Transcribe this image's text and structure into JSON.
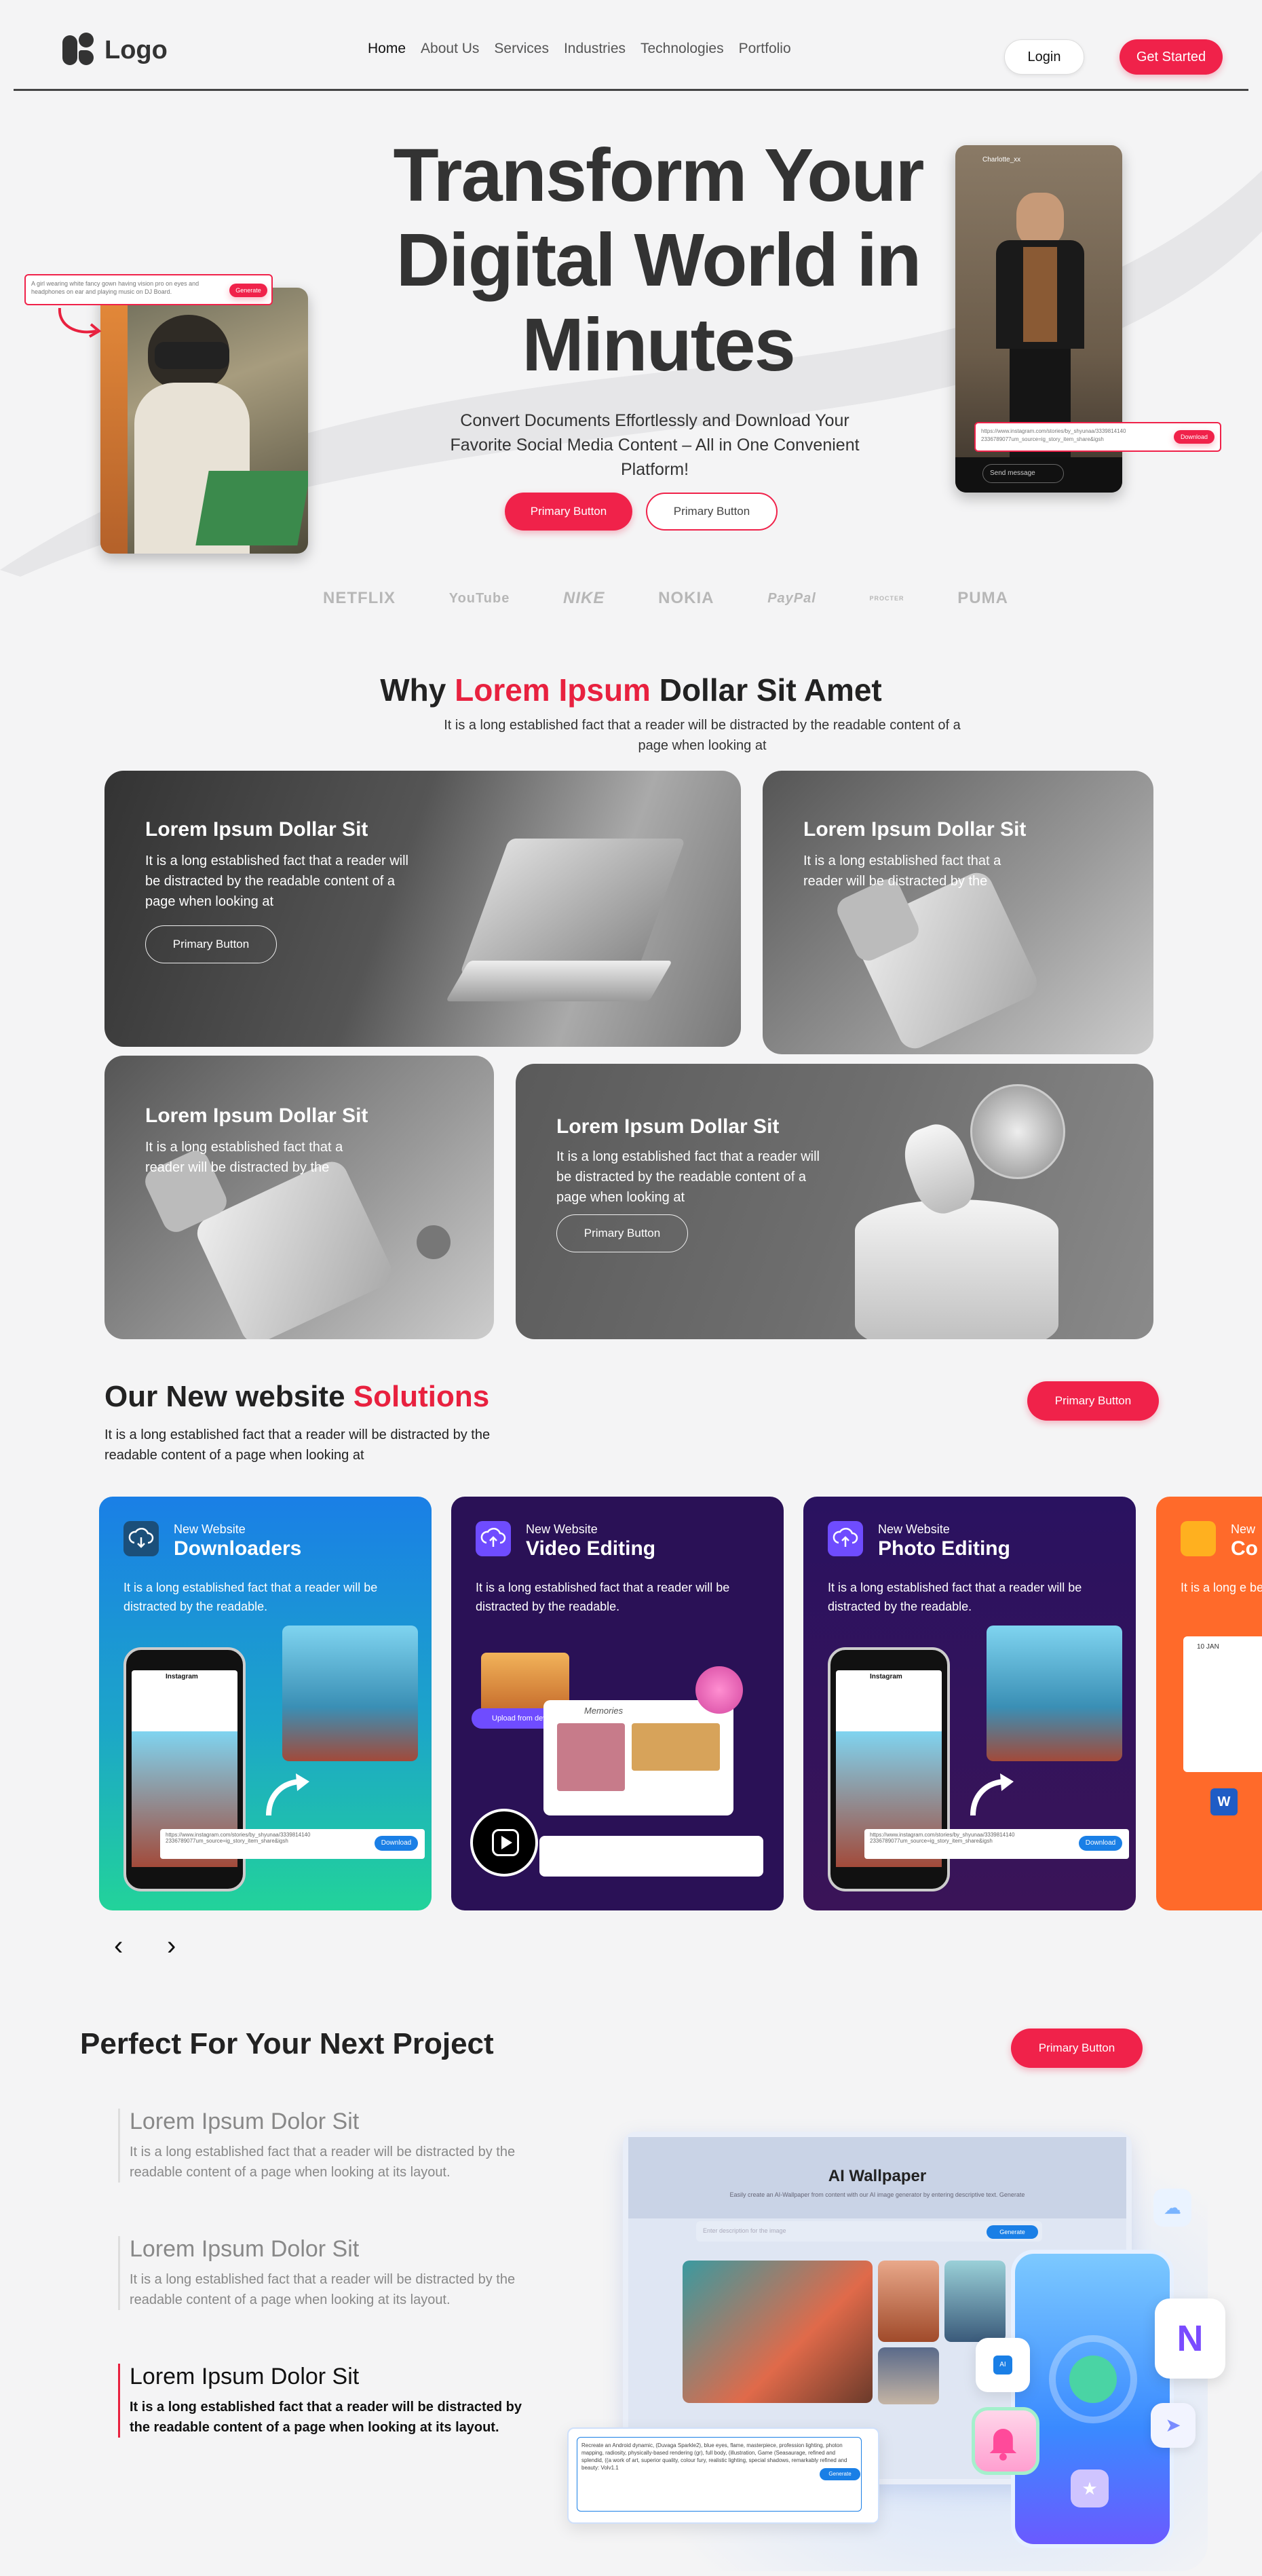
{
  "nav": {
    "logo_text": "Logo",
    "menu": [
      "Home",
      "About Us",
      "Services",
      "Industries",
      "Technologies",
      "Portfolio"
    ],
    "login_label": "Login",
    "get_started_label": "Get Started"
  },
  "hero": {
    "title_line1": "Transform Your",
    "title_line2": "Digital World in",
    "title_line3": "Minutes",
    "subtitle": "Convert Documents Effortlessly and Download Your Favorite Social Media Content – All in One Convenient Platform!",
    "primary_label": "Primary Button",
    "secondary_label": "Primary Button",
    "left_prompt": "A girl wearing white fancy gown having vision pro on eyes and headphones on ear and playing music on DJ Board.",
    "left_prompt_button": "Generate",
    "right_handle": "Charlotte_xx",
    "right_url": "https://www.instagram.com/stories/by_shyunaa/3339814140 2336789077um_source=ig_story_item_share&igsh",
    "right_url_button": "Download",
    "right_message": "Send message"
  },
  "brands": [
    "NETFLIX",
    "YouTube",
    "NIKE",
    "NOKIA",
    "PayPal",
    "PROCTER",
    "PUMA"
  ],
  "why": {
    "title_pre": "Why ",
    "title_red": "Lorem Ipsum",
    "title_post": " Dollar Sit Amet",
    "description": "It is a long established fact that a reader will be distracted by the readable content of a page when looking at",
    "cards": [
      {
        "title": "Lorem Ipsum Dollar Sit",
        "text": "It is a long established fact that a reader will be distracted by the readable content of a page when looking at",
        "button": "Primary Button"
      },
      {
        "title": "Lorem Ipsum Dollar Sit",
        "text": "It is a long established fact that a reader will be distracted by the"
      },
      {
        "title": "Lorem Ipsum Dollar Sit",
        "text": "It is a long established fact that a reader will be distracted by the"
      },
      {
        "title": "Lorem Ipsum Dollar Sit",
        "text": "It is a long established fact that a reader will be distracted by the readable content of a page when looking at",
        "button": "Primary Button"
      }
    ]
  },
  "solutions": {
    "title_pre": "Our New website ",
    "title_red": "Solutions",
    "description": "It is a long established fact that a reader will be distracted by the readable content of a page when looking at",
    "button": "Primary Button",
    "cards": [
      {
        "kicker": "New Website",
        "title": "Downloaders",
        "text": "It is a long established fact that a reader will be distracted by the readable.",
        "url": "https://www.instagram.com/stories/by_shyunaa/3339814140 2336789077um_source=ig_story_item_share&igsh",
        "url_button": "Download",
        "tag": "Instagram"
      },
      {
        "kicker": "New Website",
        "title": "Video Editing",
        "text": "It is a long established fact that a reader will be distracted by the readable.",
        "chip": "Upload from device",
        "album": "Memories"
      },
      {
        "kicker": "New Website",
        "title": "Photo Editing",
        "text": "It is a long established fact that a reader will be distracted by the readable.",
        "url": "https://www.instagram.com/stories/by_shyunaa/3339814140 2336789077um_source=ig_story_item_share&igsh",
        "url_button": "Download",
        "tag": "Instagram"
      },
      {
        "kicker": "New",
        "title": "Co",
        "text": "It is a long e be distracte",
        "date": "10 JAN"
      }
    ],
    "prev_label": "‹",
    "next_label": "›"
  },
  "project": {
    "title": "Perfect For Your Next Project",
    "button": "Primary Button",
    "features": [
      {
        "title": "Lorem Ipsum Dolor Sit",
        "text": "It is a long established fact that a reader will be distracted by the readable content of a page when looking at its layout."
      },
      {
        "title": "Lorem Ipsum Dolor Sit",
        "text": "It is a long established fact that a reader will be distracted by the readable content of a page when looking at its layout."
      },
      {
        "title": "Lorem Ipsum Dolor Sit",
        "text": "It is a long established fact that a reader will be distracted by the readable content of a page when looking at its layout."
      }
    ],
    "mockup": {
      "title": "AI Wallpaper",
      "subtitle": "Easily create an AI-Wallpaper from content with our AI image generator by entering descriptive text. Generate",
      "search_placeholder": "Enter description for the image",
      "generate": "Generate",
      "ai_badge": "AI",
      "prompt_text": "Recreate an Android dynamic, (Duvaga Sparkle2), blue eyes, flame, masterpiece, profession lighting, photon mapping, radiosity, physically-based rendering (gr), full body, (illustration, Game (Seasaurage, refined and splendid, ((a work of art, superior quality, colour fury, realistic lighting, special shadows, remarkably refined and beauty: Volv1.1",
      "prompt_button": "Generate"
    }
  },
  "colors": {
    "accent": "#f0224a",
    "downloader_gradient": [
      "#1a7fe6",
      "#22d39a"
    ],
    "video_bg": "#2a1156",
    "photo_bg": "#2a1156",
    "collage_bg": "#ff6a2a"
  }
}
